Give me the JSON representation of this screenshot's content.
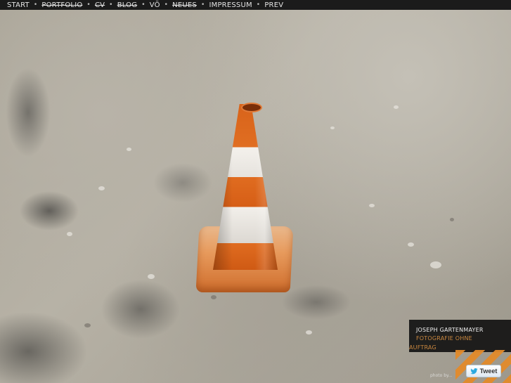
{
  "nav": {
    "items": [
      {
        "label": "START",
        "struck": false
      },
      {
        "label": "PORTFOLIO",
        "struck": true
      },
      {
        "label": "CV",
        "struck": true
      },
      {
        "label": "BLOG",
        "struck": true
      },
      {
        "label": "VÖ",
        "struck": false
      },
      {
        "label": "NEUES",
        "struck": true
      },
      {
        "label": "IMPRESSUM",
        "struck": false
      },
      {
        "label": "PREV",
        "struck": false
      }
    ],
    "separator": "•"
  },
  "info": {
    "name": "JOSEPH GARTENMAYER",
    "tagline": "FOTOGRAFIE OHNE",
    "tagline_continued": "AUFTRAG"
  },
  "credit": "photo by...",
  "tweet": {
    "label": "Tweet",
    "icon": "twitter-bird-icon"
  },
  "colors": {
    "nav_bg": "#1b1b1b",
    "accent_orange": "#c9873f",
    "stripe_orange": "#e28a2a"
  }
}
